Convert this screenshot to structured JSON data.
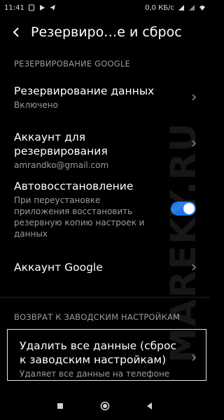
{
  "status": {
    "time": "11:41",
    "network_speed": "0,0 КБ/с"
  },
  "header": {
    "title": "Резервиро…е и сброс"
  },
  "google_section": {
    "header": "РЕЗЕРВИРОВАНИЕ GOOGLE",
    "backup": {
      "title": "Резервирование данных",
      "subtitle": "Включено"
    },
    "account": {
      "title": "Аккаунт для резервирования",
      "subtitle": "amrandko@gmail.com"
    },
    "auto_restore": {
      "title": "Автовосстановление",
      "subtitle": "При переустановке приложения восстановить резервную копию настроек и данных",
      "enabled": true
    },
    "google_account": {
      "title": "Аккаунт Google"
    }
  },
  "reset_section": {
    "header": "ВОЗВРАТ К ЗАВОДСКИМ НАСТРОЙКАМ",
    "factory_reset": {
      "title": "Удалить все данные (сброс к заводским настройкам)",
      "subtitle": "Удаляет все данные на телефоне"
    }
  },
  "watermark": "MAREKY.RU",
  "icons": {
    "back": "back-arrow-icon",
    "chevron": "chevron-right-icon",
    "nav": [
      "square-icon",
      "circle-icon",
      "triangle-icon"
    ]
  },
  "colors": {
    "background": "#000000",
    "toggle_on": "#1a73e8",
    "secondary_text": "#9b9b9b"
  }
}
